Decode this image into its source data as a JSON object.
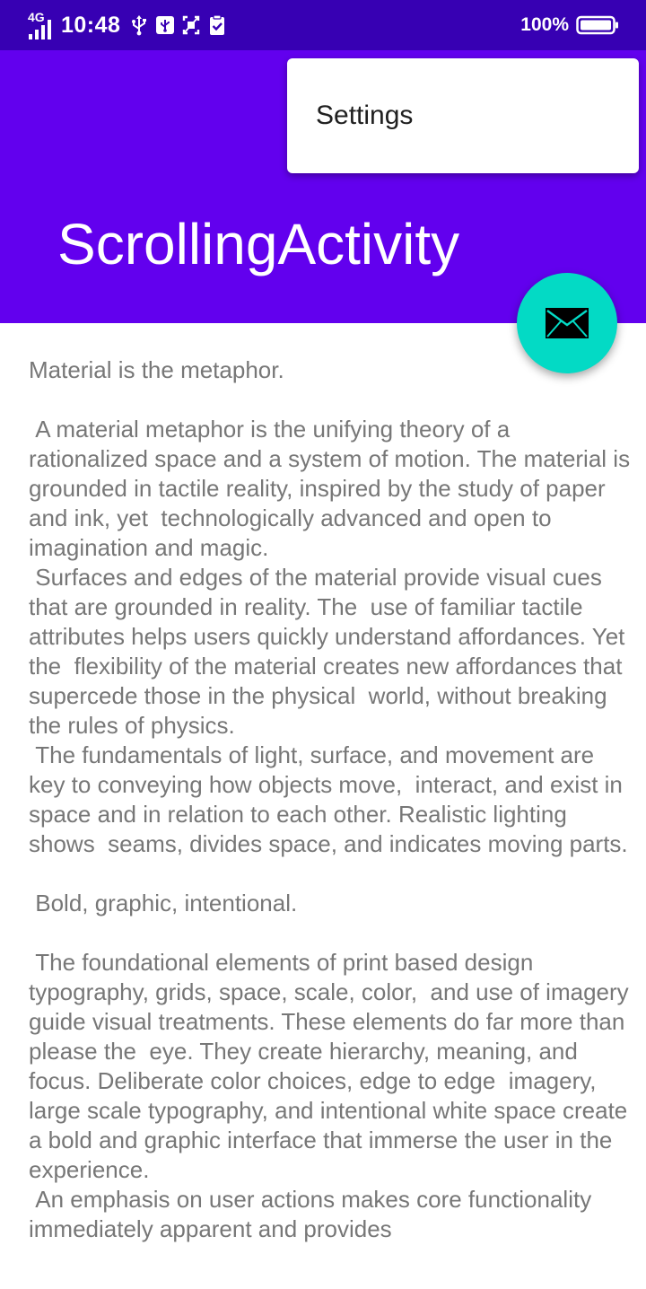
{
  "status_bar": {
    "network": "4G",
    "time": "10:48",
    "battery": "100%",
    "icons": [
      "signal-icon",
      "usb-icon",
      "usb-debug-icon",
      "screenshot-icon",
      "clipboard-check-icon",
      "battery-icon"
    ]
  },
  "menu": {
    "items": [
      {
        "label": "Settings"
      }
    ]
  },
  "toolbar": {
    "title": "ScrollingActivity"
  },
  "fab": {
    "icon": "email-icon"
  },
  "content": {
    "text": "Material is the metaphor.\n\n A material metaphor is the unifying theory of a rationalized space and a system of motion. The material is grounded in tactile reality, inspired by the study of paper and ink, yet  technologically advanced and open to imagination and magic.\n Surfaces and edges of the material provide visual cues that are grounded in reality. The  use of familiar tactile attributes helps users quickly understand affordances. Yet the  flexibility of the material creates new affordances that supercede those in the physical  world, without breaking the rules of physics.\n The fundamentals of light, surface, and movement are key to conveying how objects move,  interact, and exist in space and in relation to each other. Realistic lighting shows  seams, divides space, and indicates moving parts.\n\n Bold, graphic, intentional.\n\n The foundational elements of print based design typography, grids, space, scale, color,  and use of imagery guide visual treatments. These elements do far more than please the  eye. They create hierarchy, meaning, and focus. Deliberate color choices, edge to edge  imagery, large scale typography, and intentional white space create a bold and graphic interface that immerse the user in the experience.\n An emphasis on user actions makes core functionality immediately apparent and provides"
  },
  "colors": {
    "status_bar": "#3700b3",
    "app_bar": "#6200ee",
    "fab": "#03dac5",
    "body_text": "#777777"
  }
}
